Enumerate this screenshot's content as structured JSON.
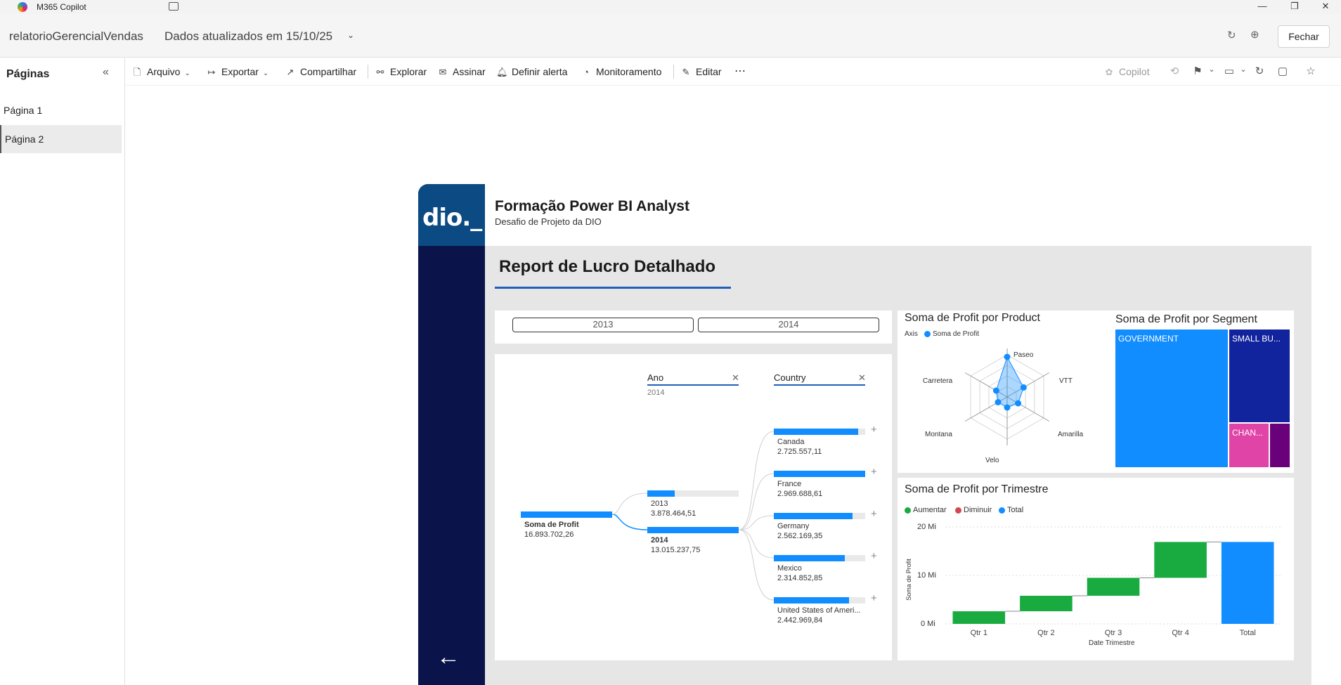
{
  "app": {
    "title": "M365 Copilot"
  },
  "header": {
    "report_name": "relatorioGerencialVendas",
    "updated": "Dados atualizados em 15/10/25",
    "close_label": "Fechar"
  },
  "sidebar": {
    "title": "Páginas",
    "pages": [
      {
        "label": "Página 1"
      },
      {
        "label": "Página 2"
      }
    ]
  },
  "toolbar": {
    "arquivo": "Arquivo",
    "exportar": "Exportar",
    "compartilhar": "Compartilhar",
    "explorar": "Explorar",
    "assinar": "Assinar",
    "definir_alerta": "Definir alerta",
    "monitoramento": "Monitoramento",
    "editar": "Editar",
    "more": "⋯",
    "copilot": "Copilot"
  },
  "report": {
    "logo_text": "dio._",
    "title": "Formação Power BI Analyst",
    "subtitle": "Desafio de Projeto da DIO",
    "section_title": "Report de Lucro Detalhado",
    "slicer": [
      "2013",
      "2014"
    ]
  },
  "decomp": {
    "ano_header": "Ano",
    "ano_selected": "2014",
    "country_header": "Country",
    "root": {
      "label": "Soma de Profit",
      "value": "16.893.702,26"
    },
    "years": [
      {
        "label": "2013",
        "value": "3.878.464,51",
        "fraction": 0.3
      },
      {
        "label": "2014",
        "value": "13.015.237,75",
        "fraction": 1.0
      }
    ],
    "countries": [
      {
        "label": "Canada",
        "value": "2.725.557,11",
        "fraction": 0.92
      },
      {
        "label": "France",
        "value": "2.969.688,61",
        "fraction": 1.0
      },
      {
        "label": "Germany",
        "value": "2.562.169,35",
        "fraction": 0.86
      },
      {
        "label": "Mexico",
        "value": "2.314.852,85",
        "fraction": 0.78
      },
      {
        "label": "United States of Ameri...",
        "value": "2.442.969,84",
        "fraction": 0.82
      }
    ]
  },
  "radar": {
    "title": "Soma de Profit por Product",
    "legend_axis": "Axis",
    "legend_series": "Soma de Profit",
    "axes": [
      "Paseo",
      "VTT",
      "Amarilla",
      "Velo",
      "Montana",
      "Carretera"
    ],
    "relative_values": [
      0.95,
      0.45,
      0.3,
      0.25,
      0.25,
      0.3
    ]
  },
  "treemap": {
    "title": "Soma de Profit por Segment",
    "labels": [
      "GOVERNMENT",
      "SMALL BU...",
      "CHAN..."
    ],
    "colors": [
      "#118dff",
      "#12239e",
      "#e044a7",
      "#6b007b"
    ]
  },
  "waterfall": {
    "title": "Soma de Profit por Trimestre",
    "legend": [
      {
        "label": "Aumentar",
        "color": "#1aab40"
      },
      {
        "label": "Diminuir",
        "color": "#d64550"
      },
      {
        "label": "Total",
        "color": "#118dff"
      }
    ],
    "ylabel": "Soma de Profit",
    "xlabel": "Date Trimestre",
    "yticks": [
      "0 Mi",
      "10 Mi",
      "20 Mi"
    ]
  },
  "chart_data": {
    "type": "bar",
    "title": "Soma de Profit por Trimestre",
    "xlabel": "Date Trimestre",
    "ylabel": "Soma de Profit",
    "categories": [
      "Qtr 1",
      "Qtr 2",
      "Qtr 3",
      "Qtr 4",
      "Total"
    ],
    "series": [
      {
        "name": "Aumentar",
        "start": [
          0,
          2.6,
          5.8,
          9.5
        ],
        "end": [
          2.6,
          5.8,
          9.5,
          16.9
        ]
      },
      {
        "name": "Total",
        "values": [
          16.9
        ]
      }
    ],
    "ylim": [
      0,
      20
    ],
    "unit": "Mi"
  }
}
